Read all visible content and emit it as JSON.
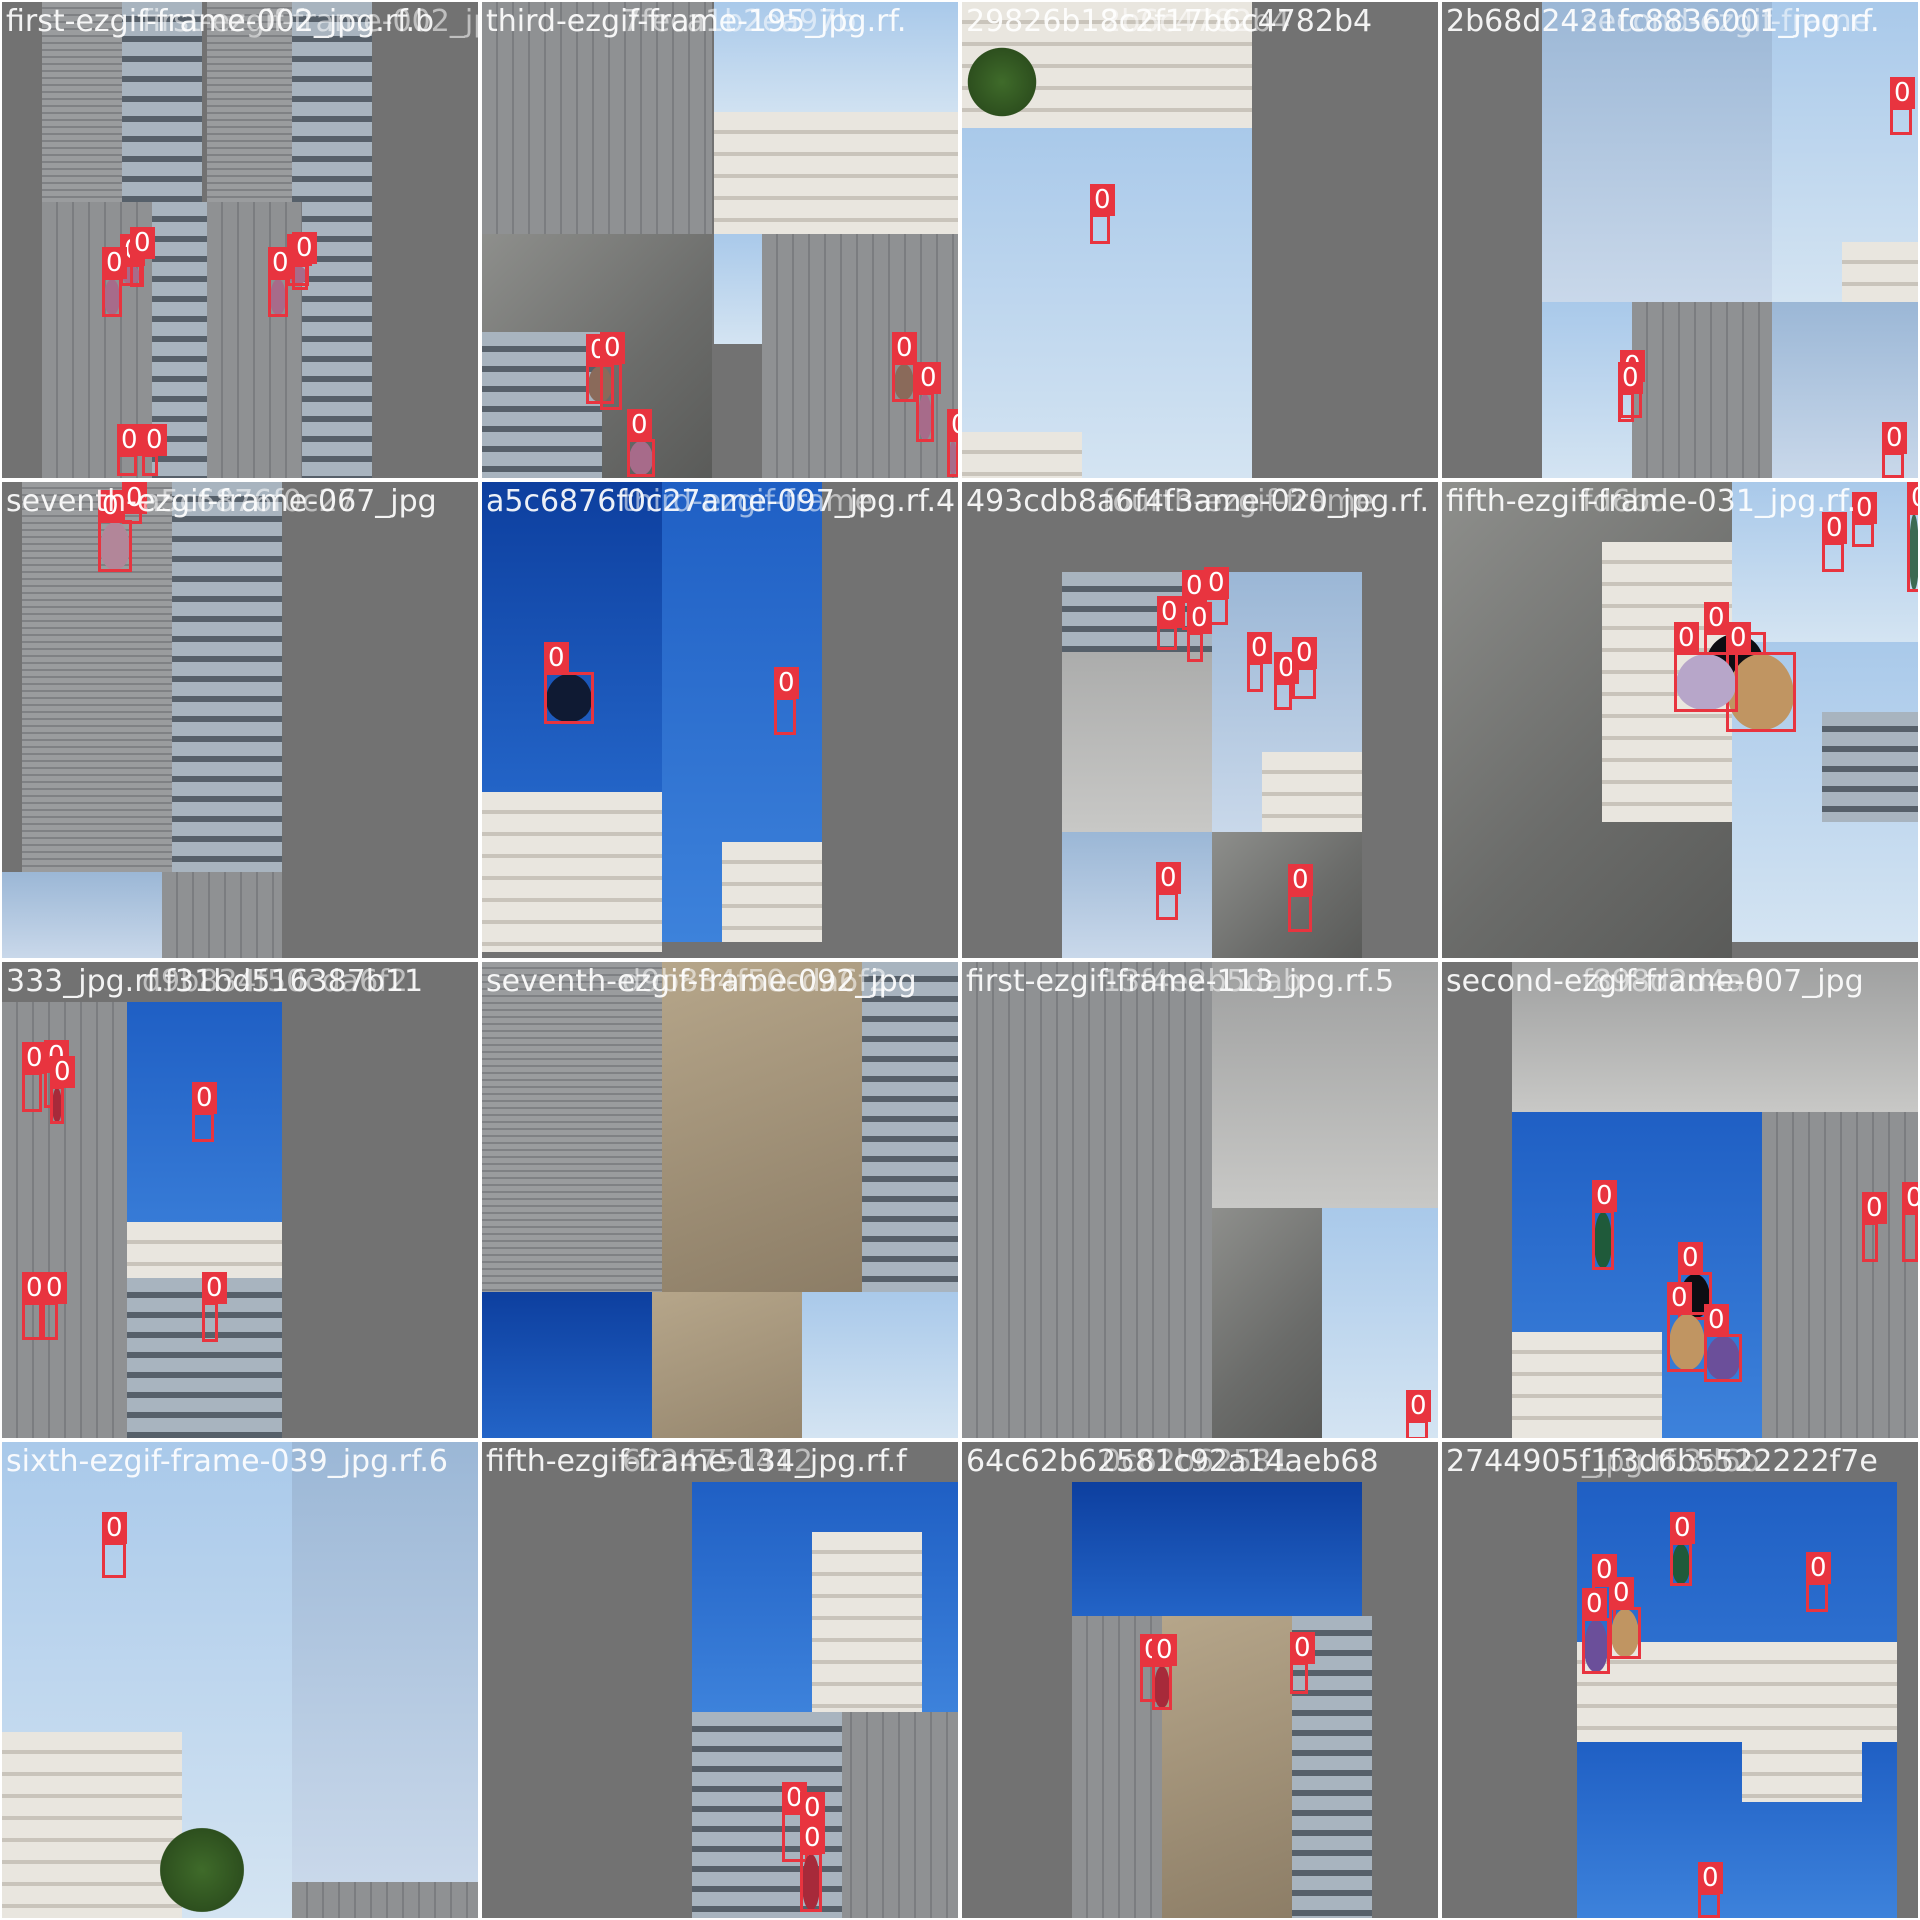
{
  "mosaic": {
    "class_label": "0",
    "box_color": "#e8343f",
    "tiles": [
      {
        "name": "first-ezgif-frame-002_jpg.rf.b",
        "overlay": "first-ezgif-frame-002_jpg.rf.b",
        "detections": 8
      },
      {
        "name": "third-ezgif-frame-195_jpg.rf.",
        "overlay": "7feca1b2ea97b",
        "detections": 6
      },
      {
        "name": "29826b18c2f17b6c4782b4",
        "overlay": "2b6c4782b4",
        "detections": 1
      },
      {
        "name": "2b68d2421fc8836001_jpg.rf.",
        "overlay": "second-ezgif-frame",
        "detections": 3
      },
      {
        "name": "seventh-ezgif-frame-067_jpg",
        "overlay": "a5c6876f0c27",
        "detections": 2
      },
      {
        "name": "a5c6876f0c27ame-097_jpg.rf.4",
        "overlay": "third-ezgif-frame",
        "detections": 3
      },
      {
        "name": "493cdb8a6f4f3ame-020_jpg.rf.",
        "overlay": "fourth-ezgif-frame",
        "detections": 9
      },
      {
        "name": "fifth-ezgif-frame-031_jpg.rf.",
        "overlay": "fd6bd",
        "detections": 6
      },
      {
        "name": "333_jpg.rf.f31bd516387b11",
        "overlay": "d9b834f50cda6f2",
        "detections": 7
      },
      {
        "name": "seventh-ezgif-frame-092_jpg",
        "overlay": "d9b834f50cda6f2",
        "detections": 0
      },
      {
        "name": "first-ezgif-frame-113_jpg.rf.5",
        "overlay": "13f4e2b5dab",
        "detections": 1
      },
      {
        "name": "second-ezgif-frame-007_jpg",
        "overlay": "f898d2d4a8",
        "detections": 6
      },
      {
        "name": "sixth-ezgif-frame-039_jpg.rf.6",
        "overlay": "",
        "detections": 1
      },
      {
        "name": "fifth-ezgif-frame-134_jpg.rf.f",
        "overlay": "622475d412",
        "detections": 3
      },
      {
        "name": "64c62b62581c92a14aeb68",
        "overlay": "0c62b62581",
        "detections": 4
      },
      {
        "name": "2744905f1f3d6b5522222f7e",
        "overlay": "_jpg.rf.3d6b",
        "detections": 6
      }
    ]
  }
}
